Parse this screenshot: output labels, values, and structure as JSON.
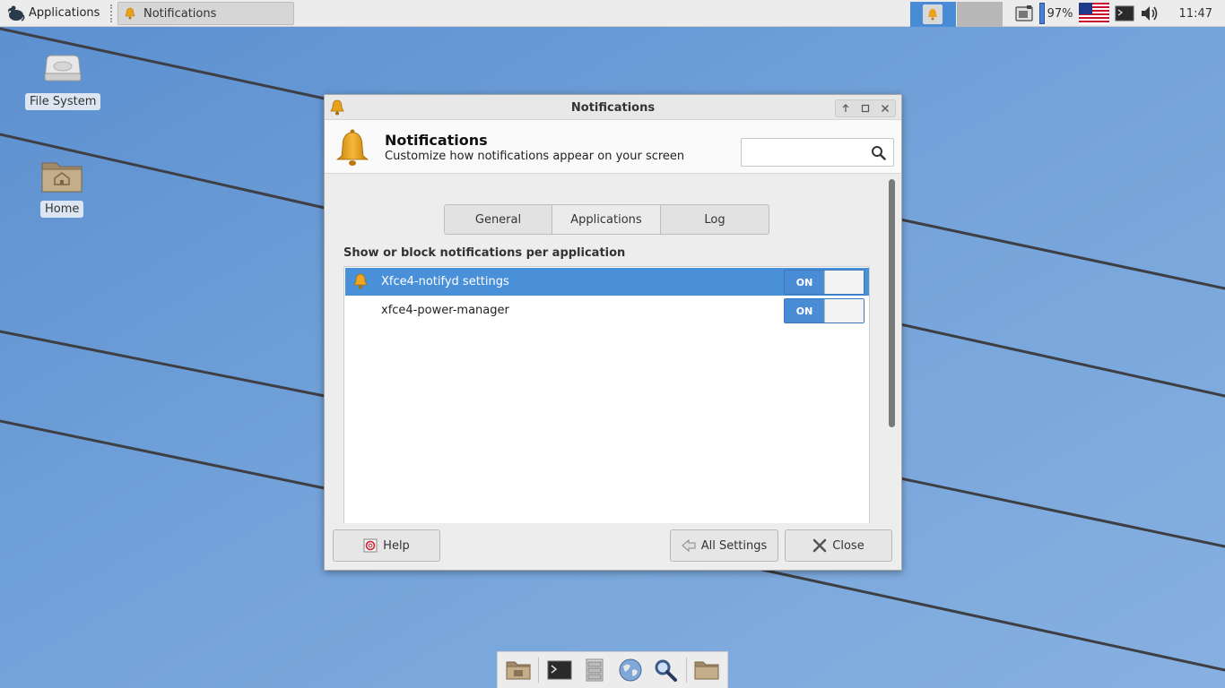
{
  "panel": {
    "apps_menu_label": "Applications",
    "task_label": "Notifications",
    "battery": "97%",
    "clock": "11:47"
  },
  "desktop": {
    "icons": [
      {
        "label": "File System",
        "icon": "drive-icon"
      },
      {
        "label": "Home",
        "icon": "home-folder-icon"
      }
    ]
  },
  "dialog": {
    "window_title": "Notifications",
    "header_title": "Notifications",
    "header_subtitle": "Customize how notifications appear on your screen",
    "search_placeholder": "",
    "tabs": [
      {
        "label": "General",
        "active": false
      },
      {
        "label": "Applications",
        "active": true
      },
      {
        "label": "Log",
        "active": false
      }
    ],
    "section_label": "Show or block notifications per application",
    "apps": [
      {
        "name": "Xfce4-notifyd settings",
        "toggle": "ON",
        "selected": true,
        "icon": "bell-icon"
      },
      {
        "name": "xfce4-power-manager",
        "toggle": "ON",
        "selected": false,
        "icon": ""
      }
    ],
    "buttons": {
      "help": "Help",
      "all_settings": "All Settings",
      "close": "Close"
    }
  },
  "colors": {
    "accent": "#4a8bd6",
    "selection": "#4a90d9",
    "wallpaper": "#6f9ed6"
  }
}
